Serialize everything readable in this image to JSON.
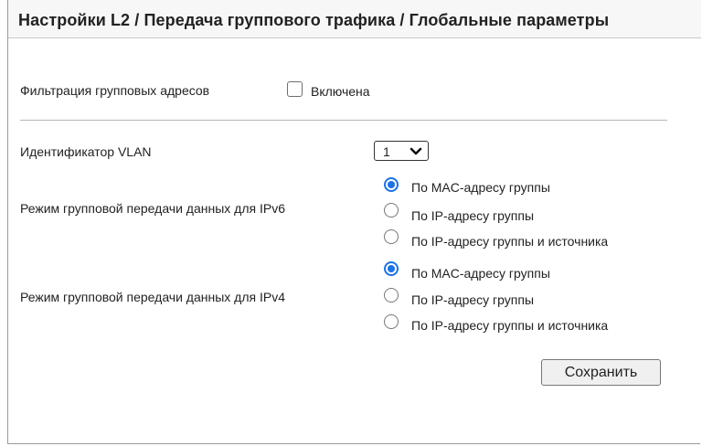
{
  "header": {
    "title": "Настройки L2 / Передача группового трафика / Глобальные параметры"
  },
  "filtering": {
    "label": "Фильтрация групповых адресов",
    "checkbox_label": "Включена",
    "checked": false
  },
  "vlan": {
    "label": "Идентификатор VLAN",
    "selected": "1"
  },
  "ipv6": {
    "label": "Режим групповой передачи данных для IPv6",
    "options": [
      "По MAC-адресу группы",
      "По IP-адресу группы",
      "По IP-адресу группы и источника"
    ],
    "selected_index": 0
  },
  "ipv4": {
    "label": "Режим групповой передачи данных для IPv4",
    "options": [
      "По MAC-адресу группы",
      "По IP-адресу группы",
      "По IP-адресу группы и источника"
    ],
    "selected_index": 0
  },
  "actions": {
    "save_label": "Сохранить"
  },
  "colors": {
    "accent": "#1a73e8",
    "header_bg": "#f7f7f7"
  },
  "icons": {
    "select_arrow": "chevron-down-icon"
  }
}
